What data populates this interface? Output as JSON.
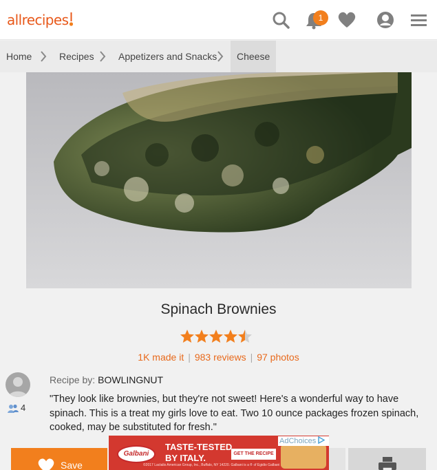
{
  "header": {
    "logo_text": "allrecipes",
    "notification_count": "1",
    "icons": [
      "search-icon",
      "bell-icon",
      "heart-icon",
      "user-icon",
      "menu-icon"
    ],
    "brand_color": "#e8591b",
    "accent_color": "#f27f1d"
  },
  "breadcrumb": {
    "items": [
      "Home",
      "Recipes",
      "Appetizers and Snacks",
      "Cheese"
    ]
  },
  "recipe": {
    "title": "Spinach Brownies",
    "rating": 4.5,
    "made_it": "1K made it",
    "reviews": "983 reviews",
    "photos": "97 photos",
    "separator": "|",
    "recipe_by_label": "Recipe by:",
    "author": "BOWLINGNUT",
    "followers": "4",
    "description": "\"They look like brownies, but they're not sweet! Here's a wonderful way to have spinach. This is a treat my girls love to eat. Two 10 ounce packages frozen spinach, cooked, may be substituted for fresh.\""
  },
  "actions": {
    "save_label": "Save"
  },
  "ad": {
    "brand": "Galbani",
    "headline_line1": "TASTE-TESTED",
    "headline_line2": "BY ITALY.",
    "cta": "GET THE RECIPE ▶",
    "adchoices": "AdChoices",
    "fine_print": "©2017 Lactalis American Group, Inc., Buffalo, NY 14220. Galbani is a ® of Egidio Galbani S.r.l."
  }
}
